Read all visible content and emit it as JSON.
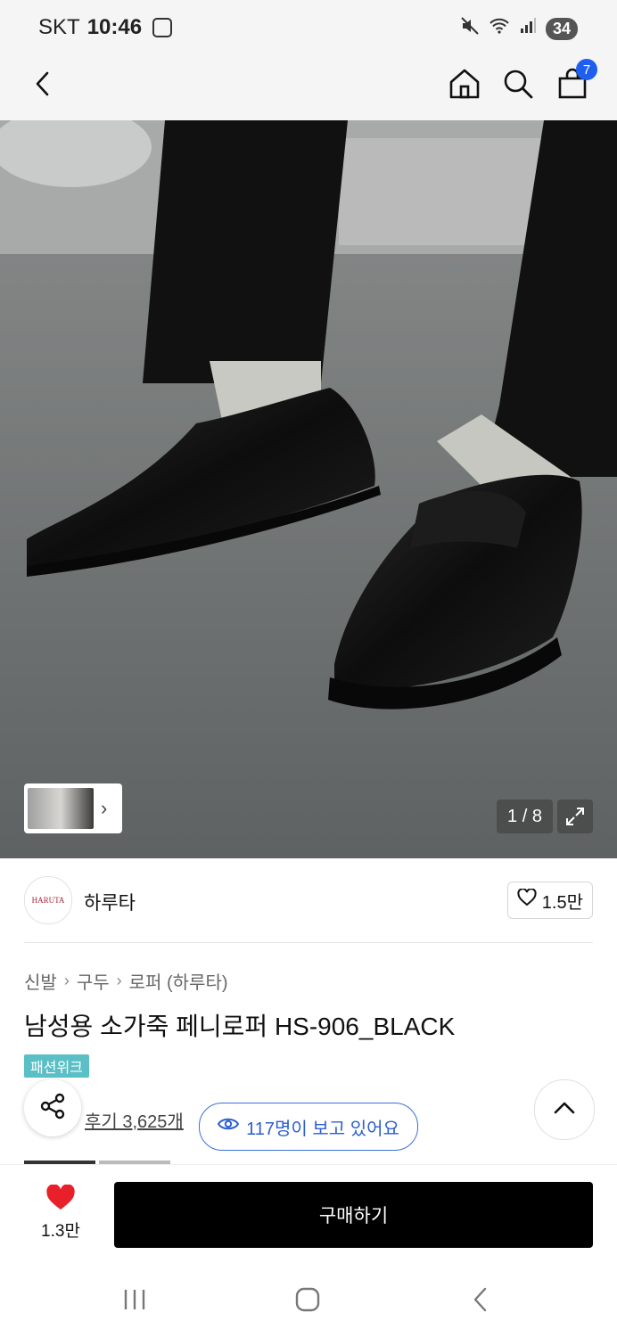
{
  "status": {
    "carrier": "SKT",
    "time": "10:46",
    "battery": "34"
  },
  "header": {
    "cart_count": "7",
    "icons": [
      "back-icon",
      "home-icon",
      "search-icon",
      "shopping-bag-icon"
    ]
  },
  "gallery": {
    "counter": "1 / 8"
  },
  "brand": {
    "logo_text": "HARUTA",
    "name": "하루타",
    "like_count": "1.5만"
  },
  "breadcrumb": {
    "items": [
      "신발",
      "구두",
      "로퍼 (하루타)"
    ]
  },
  "product": {
    "title": "남성용 소가죽 페니로퍼 HS-906_BLACK",
    "tag": "패션위크",
    "reviews": "후기 3,625개",
    "viewers": "117명이 보고 있어요"
  },
  "bottom": {
    "wish_count": "1.3만",
    "buy_label": "구매하기"
  },
  "colors": {
    "accent_blue": "#2c5fcf",
    "badge_blue": "#1e5ff0",
    "tag_teal": "#5bbfc6",
    "heart_red": "#e8202a",
    "buy_black": "#000000"
  }
}
